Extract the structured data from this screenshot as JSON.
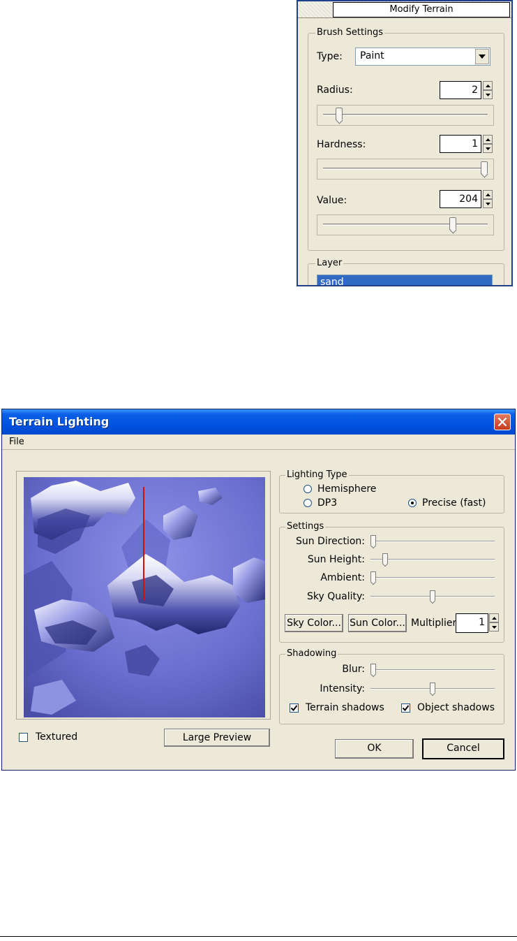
{
  "modify_terrain": {
    "title": "Modify Terrain",
    "brush_group": "Brush Settings",
    "type_label": "Type:",
    "type_value": "Paint",
    "radius": {
      "label": "Radius:",
      "value": "2",
      "slider_level": 0.08
    },
    "hardness": {
      "label": "Hardness:",
      "value": "1",
      "slider_level": 1.0
    },
    "value": {
      "label": "Value:",
      "value": "204",
      "slider_level": 0.8
    },
    "layer_group": "Layer",
    "layers": [
      "sand"
    ],
    "selected_layer": "sand"
  },
  "terrain_lighting": {
    "title": "Terrain Lighting",
    "menu": [
      "File"
    ],
    "lighting_type": {
      "legend": "Lighting Type",
      "options": [
        "Hemisphere",
        "DP3",
        "Precise (fast)"
      ],
      "selected": "Precise (fast)"
    },
    "settings": {
      "legend": "Settings",
      "sun_direction": {
        "label": "Sun Direction:",
        "level": 0.0
      },
      "sun_height": {
        "label": "Sun Height:",
        "level": 0.1
      },
      "ambient": {
        "label": "Ambient:",
        "level": 0.0
      },
      "sky_quality": {
        "label": "Sky Quality:",
        "level": 0.5
      },
      "sky_color_button": "Sky Color...",
      "sun_color_button": "Sun Color...",
      "multiplier_label": "Multiplier:",
      "multiplier_value": "1"
    },
    "shadowing": {
      "legend": "Shadowing",
      "blur": {
        "label": "Blur:",
        "level": 0.0
      },
      "intensity": {
        "label": "Intensity:",
        "level": 0.5
      },
      "terrain_shadows": {
        "label": "Terrain shadows",
        "checked": true
      },
      "object_shadows": {
        "label": "Object shadows",
        "checked": true
      }
    },
    "textured": {
      "label": "Textured",
      "checked": false
    },
    "large_preview_button": "Large Preview",
    "ok_button": "OK",
    "cancel_button": "Cancel"
  },
  "colors": {
    "dialog_bg": "#ece9d8",
    "titlebar_blue": "#0053e1",
    "selection_blue": "#316ac5",
    "terrain_base": "#6b6fd0",
    "sun_line": "#d01010"
  }
}
